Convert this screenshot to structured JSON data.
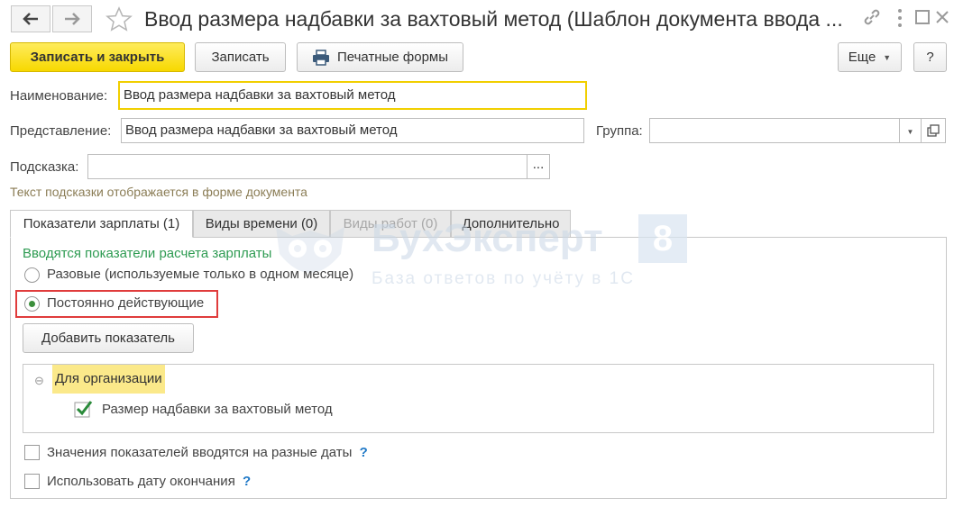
{
  "window": {
    "title": "Ввод размера надбавки за вахтовый метод (Шаблон документа ввода ...",
    "back_icon": "arrow-left-icon",
    "forward_icon": "arrow-right-icon",
    "favorite_icon": "star-icon",
    "link_icon": "link-icon",
    "menu_icon": "more-vertical-icon",
    "maximize_icon": "maximize-icon",
    "close_icon": "close-icon"
  },
  "toolbar": {
    "save_close_label": "Записать и закрыть",
    "save_label": "Записать",
    "print_label": "Печатные формы",
    "more_label": "Еще",
    "help_label": "?"
  },
  "form": {
    "name_label": "Наименование:",
    "name_value": "Ввод размера надбавки за вахтовый метод",
    "presentation_label": "Представление:",
    "presentation_value": "Ввод размера надбавки за вахтовый метод",
    "group_label": "Группа:",
    "group_value": "",
    "hint_label": "Подсказка:",
    "hint_value": "",
    "hint_button": "...",
    "hint_note": "Текст подсказки отображается в форме документа"
  },
  "tabs": [
    {
      "label": "Показатели зарплаты (1)",
      "active": true,
      "disabled": false
    },
    {
      "label": "Виды времени (0)",
      "active": false,
      "disabled": false
    },
    {
      "label": "Виды работ (0)",
      "active": false,
      "disabled": true
    },
    {
      "label": "Дополнительно",
      "active": false,
      "disabled": false
    }
  ],
  "indicators": {
    "section_title": "Вводятся показатели расчета зарплаты",
    "radio_once": "Разовые (используемые только в одном месяце)",
    "radio_permanent": "Постоянно действующие",
    "selected": "Постоянно действующие",
    "add_button": "Добавить показатель",
    "group_name": "Для организации",
    "item_label": "Размер надбавки за вахтовый метод",
    "item_checked": true,
    "different_dates_label": "Значения показателей вводятся на разные даты",
    "different_dates_checked": false,
    "end_date_label": "Использовать дату окончания",
    "end_date_checked": false,
    "question_mark": "?"
  },
  "watermark": {
    "brand": "БухЭксперт",
    "digit": "8",
    "tagline": "База ответов по учёту в 1С"
  },
  "colors": {
    "primary_button": "#f7d800",
    "highlight": "#fbe98a",
    "section_title": "#2e9b52",
    "hint_note": "#8b7d56",
    "radio_selected": "#3c8f3c",
    "annotation_frame": "#e03c3c"
  }
}
